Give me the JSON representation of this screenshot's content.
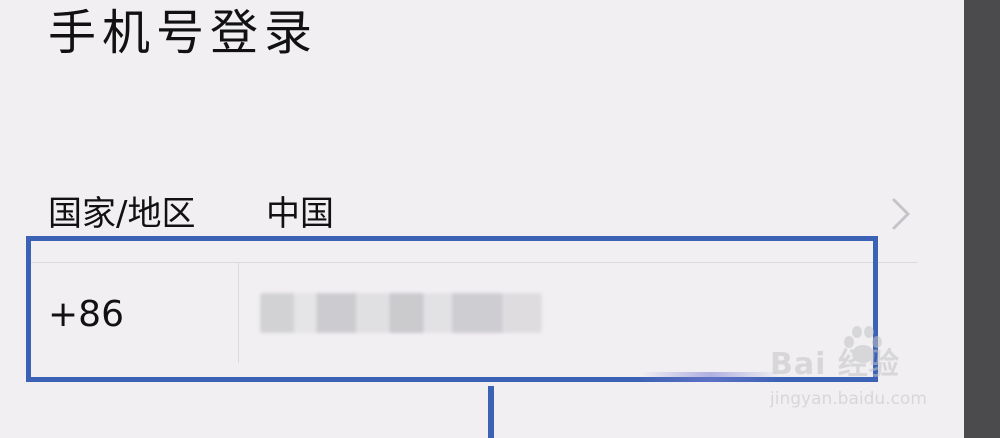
{
  "header": {
    "title": "手机号登录"
  },
  "region": {
    "label": "国家/地区",
    "value": "中国"
  },
  "phone": {
    "country_code": "+86",
    "number_redacted": ""
  },
  "watermark": {
    "main": "Bai  经验",
    "sub": "jingyan.baidu.com"
  },
  "colors": {
    "background": "#f1eff2",
    "annotation": "#3c62b5",
    "divider": "#dcdadd"
  },
  "icons": {
    "chevron": "chevron-right-icon",
    "watermark_logo": "baidu-paw-icon"
  }
}
